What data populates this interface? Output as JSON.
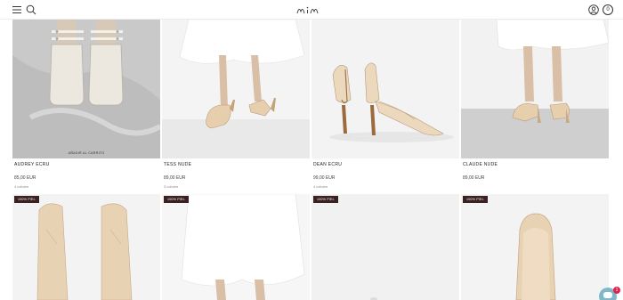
{
  "header": {
    "menu_icon": "menu-icon",
    "search_icon": "search-icon",
    "logo_text": "MIM",
    "account_icon": "user-icon",
    "cart_count": "0"
  },
  "products": [
    {
      "name": "AUDREY ECRU",
      "price": "85,00 EUR",
      "colors": "4 colores",
      "add_to_cart": "AÑADIR AL CARRITO"
    },
    {
      "name": "TESS NUDE",
      "price": "89,00 EUR",
      "colors": "3 colores"
    },
    {
      "name": "DEAN ECRU",
      "price": "99,00 EUR",
      "colors": "4 colores"
    },
    {
      "name": "CLAUDE NUDE",
      "price": "89,00 EUR",
      "colors": ""
    }
  ],
  "row2_badges": [
    "100% PIEL",
    "100% PIEL",
    "100% PIEL",
    "100% PIEL"
  ],
  "chat": {
    "icon": "chat-icon",
    "badge_count": "1"
  },
  "colors": {
    "badge": "#3b2222",
    "chat": "#7fb9c9",
    "notification": "#e0214a",
    "floor_gray": "#c9c9c9",
    "shoe_nude": "#e7cfae"
  }
}
